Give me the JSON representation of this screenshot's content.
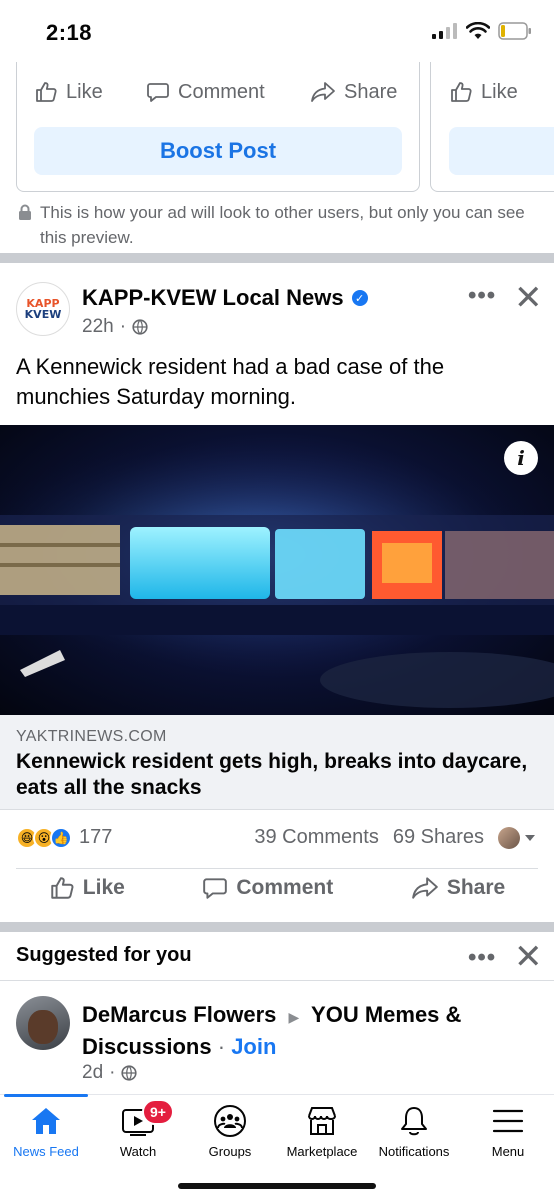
{
  "status": {
    "time": "2:18"
  },
  "ad_preview": {
    "like_label": "Like",
    "comment_label": "Comment",
    "share_label": "Share",
    "like_label_2": "Like",
    "boost_label": "Boost Post",
    "note": "This is how your ad will look to other users, but only you can see this preview."
  },
  "post": {
    "avatar_line1": "KAPP",
    "avatar_line2": "KVEW",
    "page_name": "KAPP-KVEW Local News",
    "time": "22h",
    "dot": "·",
    "text": "A Kennewick resident had a bad case of the munchies Saturday morning.",
    "info_icon": "i",
    "link_domain": "YAKTRINEWS.COM",
    "link_title": "Kennewick resident gets high, breaks into daycare, eats all the snacks",
    "reaction_count": "177",
    "comments": "39 Comments",
    "shares": "69 Shares",
    "like_label": "Like",
    "comment_label": "Comment",
    "share_label": "Share"
  },
  "suggested": {
    "title": "Suggested for you",
    "user": "DeMarcus Flowers",
    "arrow": "▶",
    "group": "YOU Memes & Discussions",
    "dot": "·",
    "join_label": "Join",
    "time": "2d",
    "dot2": "·"
  },
  "tabbar": {
    "badge": "9+",
    "tabs": [
      {
        "label": "News Feed",
        "icon": "home-icon"
      },
      {
        "label": "Watch",
        "icon": "video-icon"
      },
      {
        "label": "Groups",
        "icon": "groups-icon"
      },
      {
        "label": "Marketplace",
        "icon": "marketplace-icon"
      },
      {
        "label": "Notifications",
        "icon": "bell-icon"
      },
      {
        "label": "Menu",
        "icon": "menu-icon"
      }
    ]
  },
  "colors": {
    "accent": "#1877f2",
    "boost_bg": "#e7f3ff",
    "secondary_text": "#65676b",
    "badge": "#e41e3f",
    "separator": "#c9ccd1"
  }
}
